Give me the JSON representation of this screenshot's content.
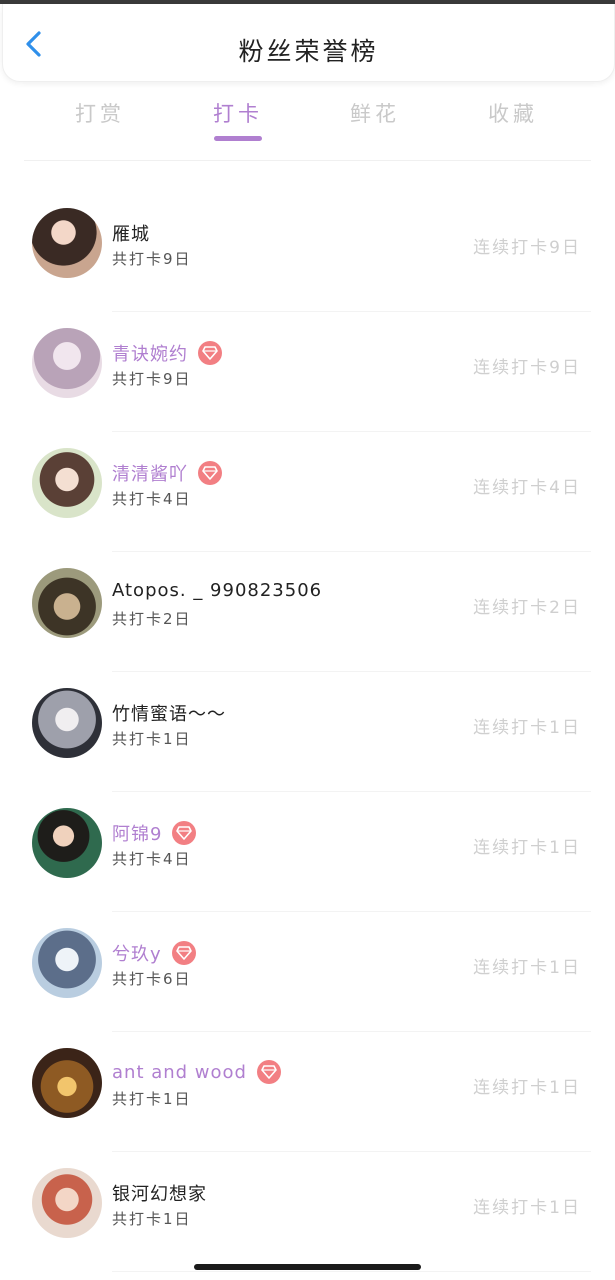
{
  "header": {
    "title": "粉丝荣誉榜",
    "back_icon": "chevron-left-icon",
    "accent": "#2f8fea"
  },
  "tabs": [
    {
      "label": "打赏",
      "active": false
    },
    {
      "label": "打卡",
      "active": true
    },
    {
      "label": "鲜花",
      "active": false
    },
    {
      "label": "收藏",
      "active": false
    }
  ],
  "colors": {
    "active_tab": "#b07fd0",
    "vip_name": "#b07fd0",
    "badge": "#f27f83",
    "streak": "#cfcfcf"
  },
  "fans": [
    {
      "name": "雁城",
      "vip": false,
      "total": "共打卡9日",
      "streak": "连续打卡9日"
    },
    {
      "name": "青诀婉约",
      "vip": true,
      "total": "共打卡9日",
      "streak": "连续打卡9日"
    },
    {
      "name": "清清酱吖",
      "vip": true,
      "total": "共打卡4日",
      "streak": "连续打卡4日"
    },
    {
      "name": "Atopos. _ 990823506",
      "vip": false,
      "total": "共打卡2日",
      "streak": "连续打卡2日"
    },
    {
      "name": "竹情蜜语～～",
      "vip": false,
      "total": "共打卡1日",
      "streak": "连续打卡1日"
    },
    {
      "name": "阿锦9",
      "vip": true,
      "total": "共打卡4日",
      "streak": "连续打卡1日"
    },
    {
      "name": "兮玖y",
      "vip": true,
      "total": "共打卡6日",
      "streak": "连续打卡1日"
    },
    {
      "name": "ant and wood",
      "vip": true,
      "total": "共打卡1日",
      "streak": "连续打卡1日"
    },
    {
      "name": "银河幻想家",
      "vip": false,
      "total": "共打卡1日",
      "streak": "连续打卡1日"
    }
  ]
}
